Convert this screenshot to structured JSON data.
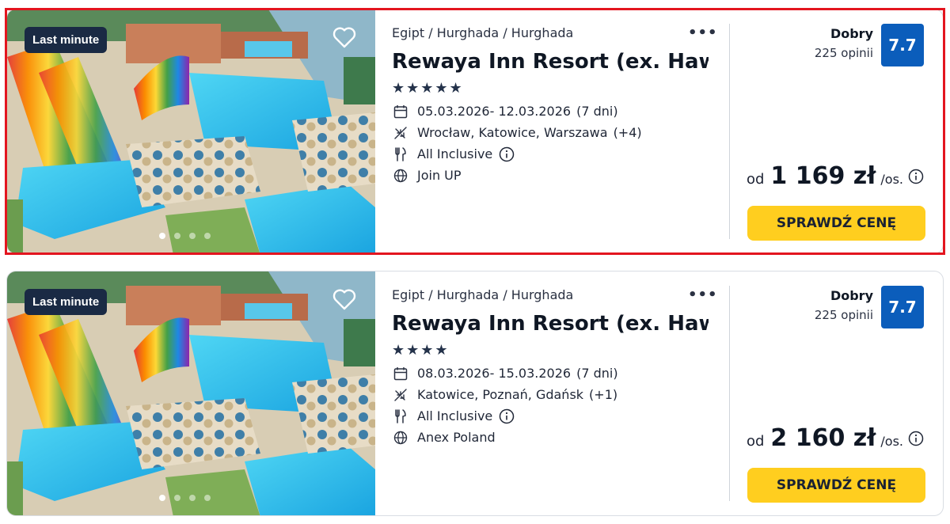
{
  "offers": [
    {
      "badge": "Last minute",
      "breadcrumb": "Egipt / Hurghada / Hurghada",
      "more_label": "•••",
      "title": "Rewaya Inn Resort (ex. Hawaii ...",
      "stars": "★★★★★",
      "star_count": 5,
      "dates": "05.03.2026- 12.03.2026",
      "duration": "(7 dni)",
      "departures": "Wrocław, Katowice, Warszawa",
      "departures_more": "(+4)",
      "board": "All Inclusive",
      "operator": "Join UP",
      "rating_label": "Dobry",
      "rating_count": "225 opinii",
      "score": "7.7",
      "price_prefix": "od",
      "price": "1 169 zł",
      "price_suffix": "/os.",
      "cta_label": "SPRAWDŹ CENĘ",
      "photo_dots_total": 4,
      "photo_dot_active": 1
    },
    {
      "badge": "Last minute",
      "breadcrumb": "Egipt / Hurghada / Hurghada",
      "more_label": "•••",
      "title": "Rewaya Inn Resort (ex. Hawaii ...",
      "stars": "★★★★",
      "star_count": 4,
      "dates": "08.03.2026- 15.03.2026",
      "duration": "(7 dni)",
      "departures": "Katowice, Poznań, Gdańsk",
      "departures_more": "(+1)",
      "board": "All Inclusive",
      "operator": "Anex Poland",
      "rating_label": "Dobry",
      "rating_count": "225 opinii",
      "score": "7.7",
      "price_prefix": "od",
      "price": "2 160 zł",
      "price_suffix": "/os.",
      "cta_label": "SPRAWDŹ CENĘ",
      "photo_dots_total": 4,
      "photo_dot_active": 1
    }
  ],
  "icons": {
    "favorite": "heart-outline-icon",
    "calendar": "calendar-icon",
    "plane": "plane-icon",
    "board": "cutlery-icon",
    "operator": "globe-icon",
    "info": "info-circle-icon"
  },
  "colors": {
    "accent_button": "#ffce1f",
    "score_badge": "#0b5dbb",
    "badge_bg": "#1a2a44",
    "highlight_border": "#e3151f"
  }
}
